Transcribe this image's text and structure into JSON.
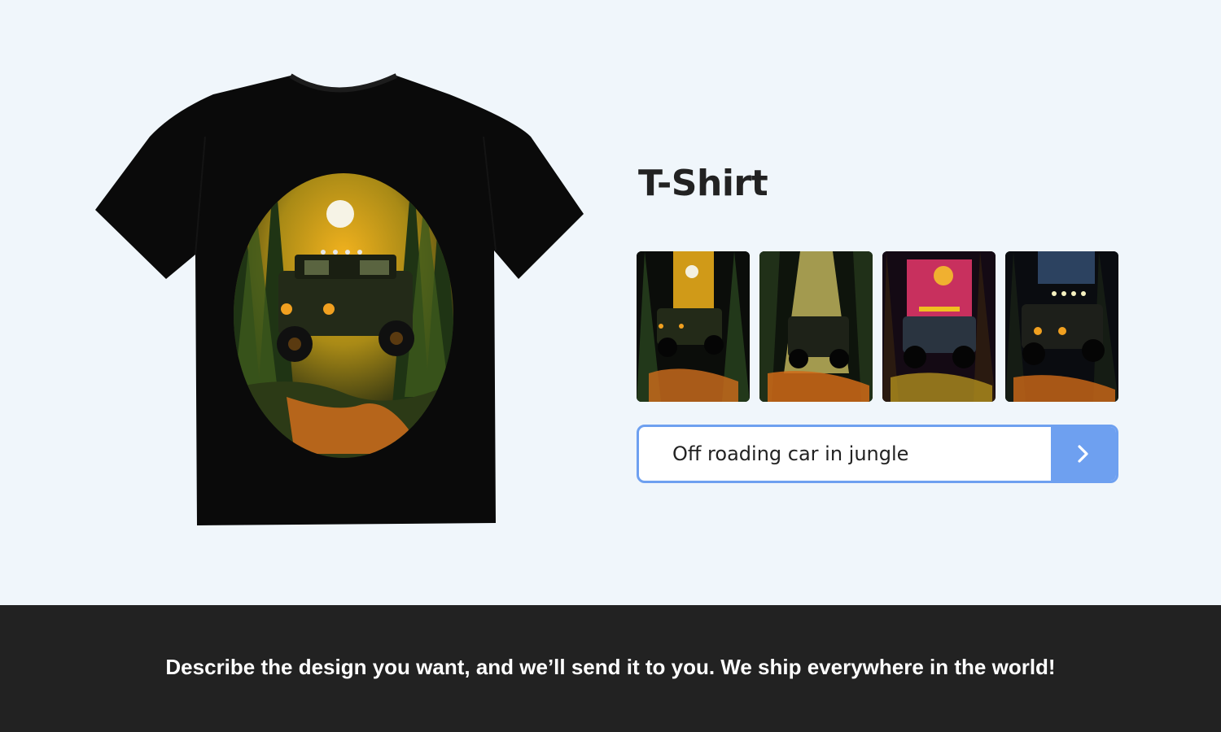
{
  "product": {
    "title": "T-Shirt",
    "image_icon": "tshirt-artwork",
    "shirt_color": "#0a0a0a"
  },
  "thumbnails": [
    {
      "name": "variant-1",
      "accent": "#f0b020"
    },
    {
      "name": "variant-2",
      "accent": "#e8d060"
    },
    {
      "name": "variant-3",
      "accent": "#e0407a"
    },
    {
      "name": "variant-4",
      "accent": "#3a5070"
    }
  ],
  "prompt": {
    "value": "Off roading car in jungle",
    "submit_icon": "chevron-right-icon"
  },
  "footer": {
    "text": "Describe the design you want, and we’ll send it to you. We ship everywhere in the world!"
  },
  "colors": {
    "background": "#f0f6fb",
    "accent": "#6ea0f0",
    "footer_bg": "#222222",
    "title": "#222222"
  }
}
